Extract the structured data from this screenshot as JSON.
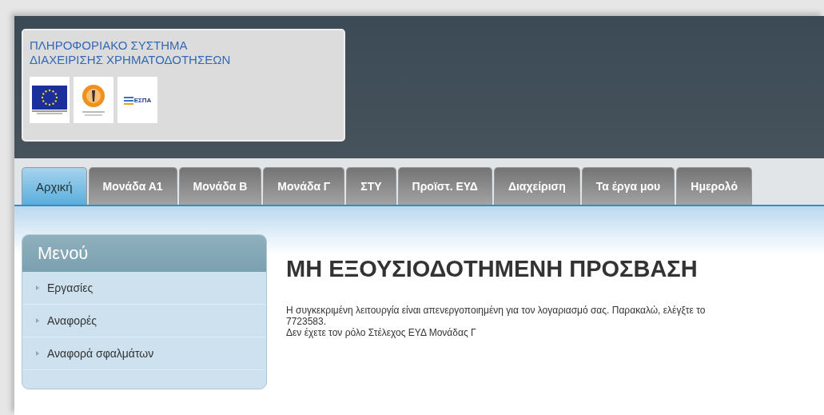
{
  "header": {
    "title_lines": [
      "ΠΛΗΡΟΦΟΡΙΑΚΟ ΣΥΣΤΗΜΑ",
      "ΔΙΑΧΕΙΡΙΣΗΣ ΧΡΗΜΑΤΟΔΟΤΗΣΕΩΝ"
    ],
    "espa_logo_text": "ΕΣΠΑ"
  },
  "tabs": [
    {
      "label": "Αρχική",
      "selected": true
    },
    {
      "label": "Μονάδα Α1",
      "selected": false
    },
    {
      "label": "Μονάδα Β",
      "selected": false
    },
    {
      "label": "Μονάδα Γ",
      "selected": false
    },
    {
      "label": "ΣΤΥ",
      "selected": false
    },
    {
      "label": "Προϊστ. ΕΥΔ",
      "selected": false
    },
    {
      "label": "Διαχείριση",
      "selected": false
    },
    {
      "label": "Τα έργα μου",
      "selected": false
    },
    {
      "label": "Ημερολό",
      "selected": false
    }
  ],
  "sidebar": {
    "title": "Μενού",
    "items": [
      "Εργασίες",
      "Αναφορές",
      "Αναφορά σφαλμάτων"
    ]
  },
  "content": {
    "heading": "ΜΗ ΕΞΟΥΣΙΟΔΟΤΗΜΕΝΗ ΠΡΟΣΒΑΣΗ",
    "lines": [
      "Η συγκεκριμένη λειτουργία είναι απενεργοποιημένη για τον λογαριασμό σας. Παρακαλώ, ελέγξτε το",
      "7723583.",
      "Δεν έχετε τον ρόλο Στέλεχος ΕΥΔ Μονάδας Γ"
    ]
  }
}
